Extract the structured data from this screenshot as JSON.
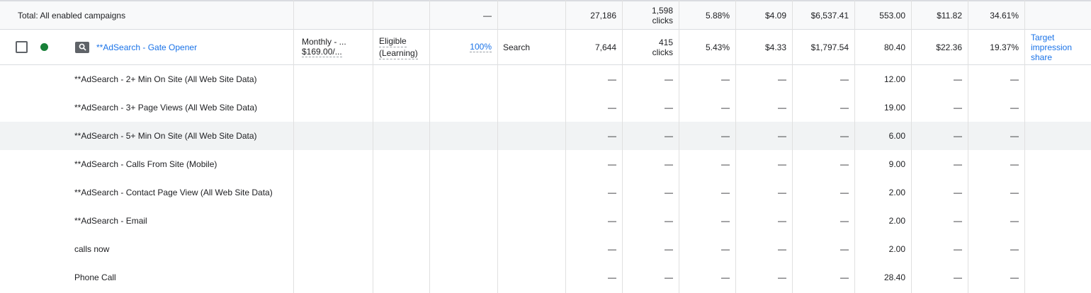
{
  "total": {
    "label": "Total: All enabled campaigns",
    "opt_score": "—",
    "impr": "27,186",
    "clicks_num": "1,598",
    "clicks_unit": "clicks",
    "ctr": "5.88%",
    "avg_cpc": "$4.09",
    "cost": "$6,537.41",
    "conversions": "553.00",
    "cost_per_conv": "$11.82",
    "conv_rate": "34.61%"
  },
  "campaign": {
    "name": "**AdSearch - Gate Opener",
    "budget_line1": "Monthly - ...",
    "budget_line2": "$169.00/...",
    "status_line1": "Eligible",
    "status_line2": "(Learning)",
    "opt_score": "100%",
    "type": "Search",
    "impr": "7,644",
    "clicks_num": "415",
    "clicks_unit": "clicks",
    "ctr": "5.43%",
    "avg_cpc": "$4.33",
    "cost": "$1,797.54",
    "conversions": "80.40",
    "cost_per_conv": "$22.36",
    "conv_rate": "19.37%",
    "bid_strategy_line1": "Target",
    "bid_strategy_line2": "impression",
    "bid_strategy_line3": "share",
    "status_color": "#188038"
  },
  "dash": "—",
  "conversion_rows": [
    {
      "name": "**AdSearch - 2+ Min On Site (All Web Site Data)",
      "conversions": "12.00"
    },
    {
      "name": "**AdSearch - 3+ Page Views (All Web Site Data)",
      "conversions": "19.00"
    },
    {
      "name": "**AdSearch - 5+ Min On Site (All Web Site Data)",
      "conversions": "6.00"
    },
    {
      "name": "**AdSearch - Calls From Site (Mobile)",
      "conversions": "9.00"
    },
    {
      "name": "**AdSearch - Contact Page View (All Web Site Data)",
      "conversions": "2.00"
    },
    {
      "name": "**AdSearch - Email",
      "conversions": "2.00"
    },
    {
      "name": "calls now",
      "conversions": "2.00"
    },
    {
      "name": "Phone Call",
      "conversions": "28.40"
    }
  ],
  "colors": {
    "link": "#1a73e8",
    "text": "#202124",
    "border": "#dadce0",
    "highlight": "#f1f3f4"
  }
}
